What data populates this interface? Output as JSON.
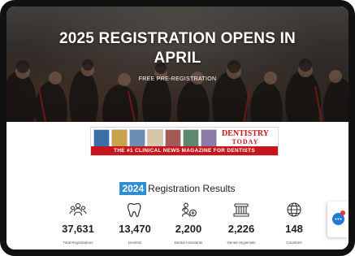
{
  "hero": {
    "title": "2025 REGISTRATION OPENS IN APRIL",
    "subtitle": "FREE PRE-REGISTRATION"
  },
  "ad": {
    "brand_line1": "DENTISTRY",
    "brand_line2": "TODAY",
    "tagline": "THE #1 CLINICAL NEWS MAGAZINE FOR DENTISTS",
    "brand_color": "#c4161c"
  },
  "results": {
    "year": "2024",
    "heading": "Registration Results",
    "accent": "#2d8fd6"
  },
  "stats": [
    {
      "icon": "people-group-icon",
      "value": "37,631",
      "label": "Total Registrations"
    },
    {
      "icon": "tooth-icon",
      "value": "13,470",
      "label": "Dentists"
    },
    {
      "icon": "add-people-icon",
      "value": "2,200",
      "label": "Dental Assistants"
    },
    {
      "icon": "dental-hygiene-icon",
      "value": "2,226",
      "label": "Dental Hygienists"
    },
    {
      "icon": "globe-icon",
      "value": "148",
      "label": "Countries"
    }
  ],
  "chat": {
    "icon": "chat-bubble-icon",
    "color": "#1f7ad6"
  }
}
